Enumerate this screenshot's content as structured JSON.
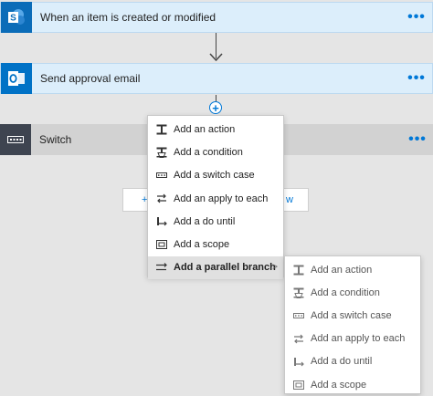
{
  "steps": [
    {
      "title": "When an item is created or modified",
      "icon": "sharepoint-icon",
      "more": "•••",
      "color": "#0b6cb8"
    },
    {
      "title": "Send approval email",
      "icon": "outlook-icon",
      "more": "•••",
      "color": "#0072c6"
    },
    {
      "title": "Switch",
      "icon": "switch-icon",
      "more": "•••",
      "color": "#3e4450"
    }
  ],
  "insert_button": {
    "symbol": "+"
  },
  "hidden_button": {
    "left_fragment": "+",
    "right_fragment": "w"
  },
  "menu_main": {
    "items": [
      {
        "label": "Add an action",
        "icon": "action-icon"
      },
      {
        "label": "Add a condition",
        "icon": "condition-icon"
      },
      {
        "label": "Add a switch case",
        "icon": "switch-case-icon"
      },
      {
        "label": "Add an apply to each",
        "icon": "apply-to-each-icon"
      },
      {
        "label": "Add a do until",
        "icon": "do-until-icon"
      },
      {
        "label": "Add a scope",
        "icon": "scope-icon"
      },
      {
        "label": "Add a parallel branch",
        "icon": "parallel-branch-icon",
        "chevron": ">",
        "highlighted": true
      }
    ]
  },
  "menu_sub": {
    "items": [
      {
        "label": "Add an action",
        "icon": "action-icon"
      },
      {
        "label": "Add a condition",
        "icon": "condition-icon"
      },
      {
        "label": "Add a switch case",
        "icon": "switch-case-icon"
      },
      {
        "label": "Add an apply to each",
        "icon": "apply-to-each-icon"
      },
      {
        "label": "Add a do until",
        "icon": "do-until-icon"
      },
      {
        "label": "Add a scope",
        "icon": "scope-icon"
      }
    ]
  },
  "colors": {
    "accent": "#0078d7",
    "background": "#e5e5e5",
    "highlight": "#e0e0e0"
  }
}
